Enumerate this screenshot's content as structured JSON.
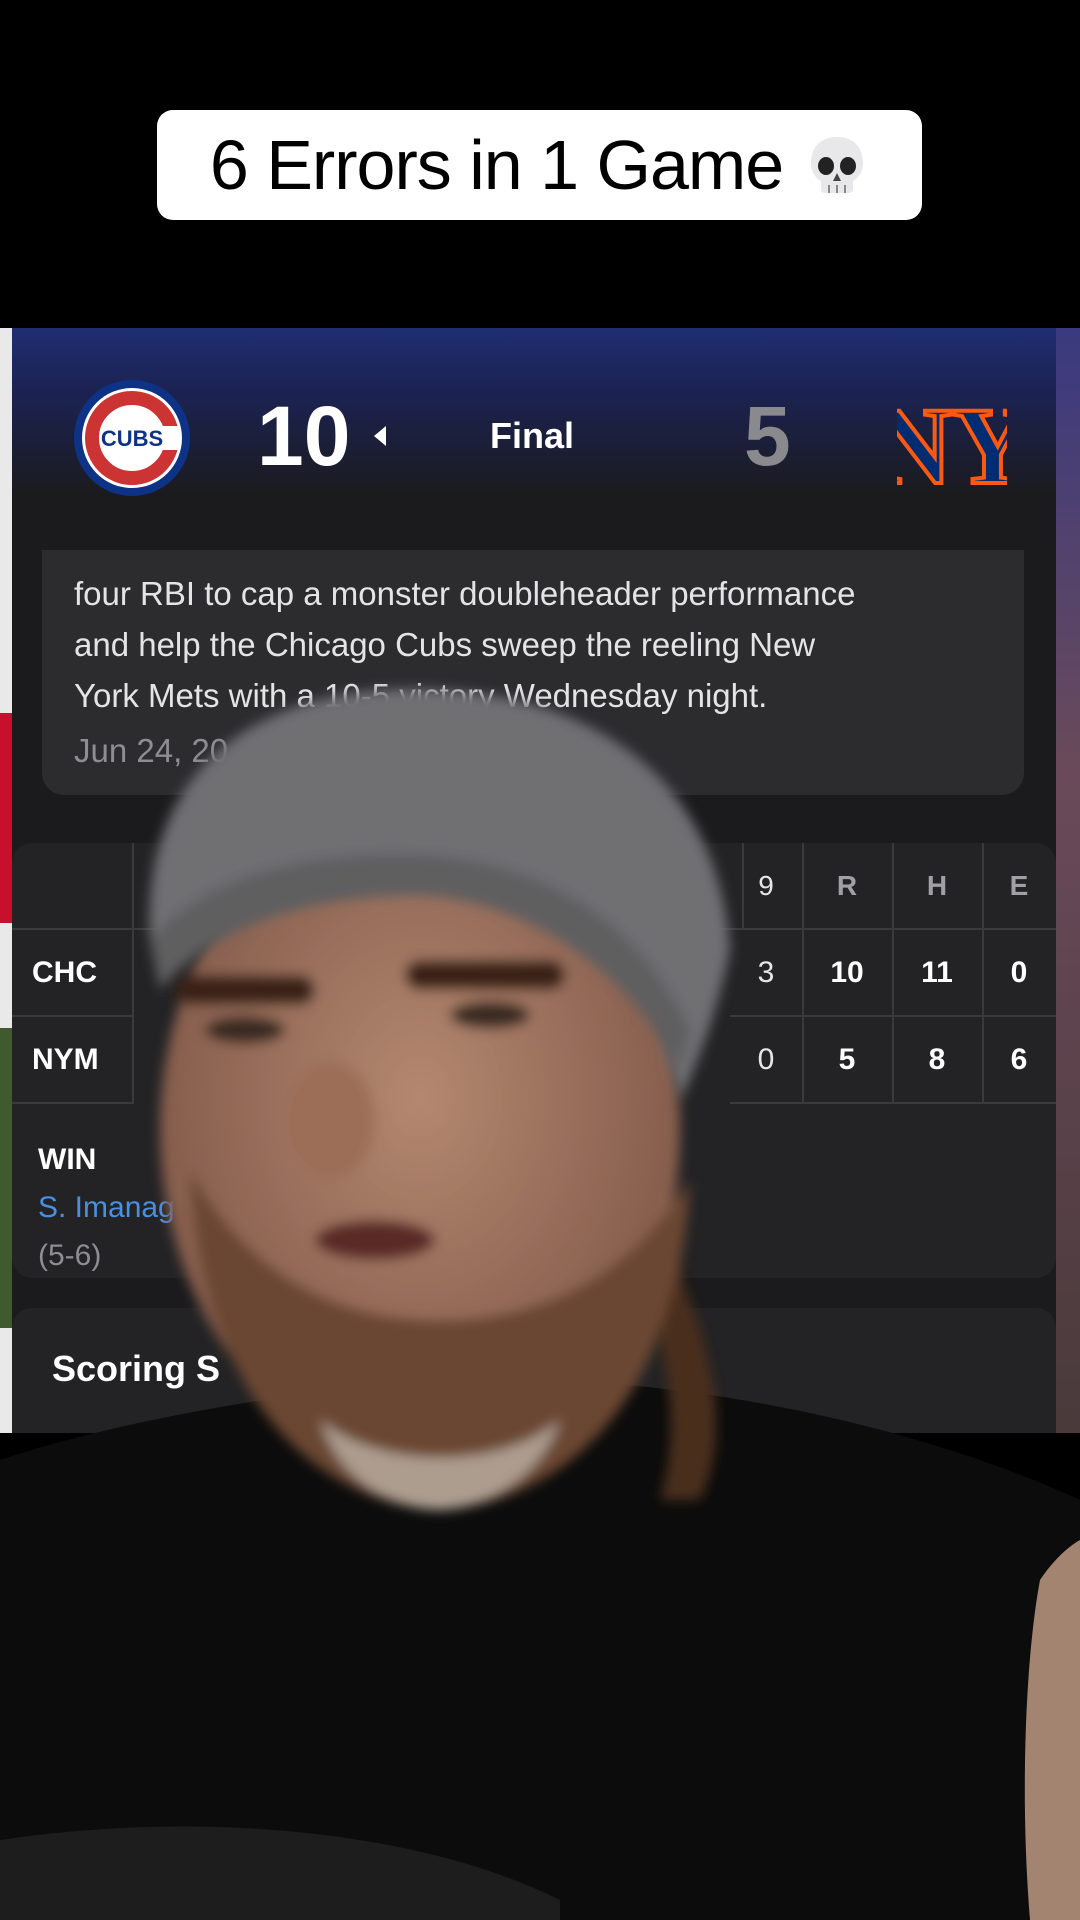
{
  "caption": {
    "text": "6 Errors in 1 Game",
    "emoji": "skull-emoji"
  },
  "game": {
    "away": {
      "abbr": "CHC",
      "score": "10",
      "logo": "cubs-logo",
      "logo_text": "CUBS"
    },
    "home": {
      "abbr": "NYM",
      "score": "5",
      "logo": "mets-logo",
      "logo_text": "NY"
    },
    "status": "Final"
  },
  "recap": {
    "lines": [
      "four RBI to cap a monster doubleheader performance",
      "and help the Chicago Cubs sweep the reeling New",
      "York Mets with a 10-5 victory Wednesday night."
    ],
    "date": "Jun 24, 20"
  },
  "box_score": {
    "headers": [
      "9",
      "R",
      "H",
      "E"
    ],
    "rows": [
      {
        "team": "CHC",
        "values": [
          "3",
          "10",
          "11",
          "0"
        ]
      },
      {
        "team": "NYM",
        "values": [
          "0",
          "5",
          "8",
          "6"
        ]
      }
    ]
  },
  "win_pitcher": {
    "label": "WIN",
    "name": "S. Imanag",
    "record": "(5-6)"
  },
  "scoring_section": {
    "title": "Scoring S"
  },
  "colors": {
    "cubs_blue": "#0e3386",
    "cubs_red": "#cc3433",
    "mets_blue": "#002d72",
    "mets_orange": "#ff5910",
    "link_blue": "#4a90e2"
  }
}
